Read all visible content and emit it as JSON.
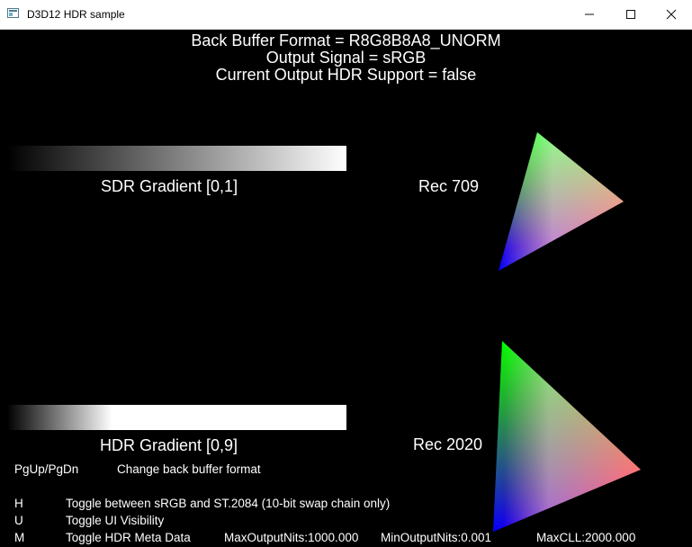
{
  "window": {
    "title": "D3D12 HDR sample"
  },
  "header": {
    "line1": "Back Buffer Format = R8G8B8A8_UNORM",
    "line2": "Output Signal = sRGB",
    "line3": "Current Output HDR Support = false"
  },
  "gradients": {
    "sdr_label": "SDR Gradient [0,1]",
    "hdr_label": "HDR Gradient [0,9]"
  },
  "gamuts": {
    "rec709_label": "Rec 709",
    "rec2020_label": "Rec 2020",
    "colors": {
      "red": "#ff0000",
      "green": "#00ff00",
      "blue": "#0000ff"
    }
  },
  "help": {
    "pgkey": "PgUp/PgDn",
    "pgdesc": "Change back buffer format",
    "h_key": "H",
    "h_desc": "Toggle between sRGB and ST.2084 (10-bit swap chain only)",
    "u_key": "U",
    "u_desc": "Toggle UI Visibility",
    "m_key": "M",
    "m_desc": "Toggle HDR Meta Data"
  },
  "metadata": {
    "max_output": "MaxOutputNits:1000.000",
    "min_output": "MinOutputNits:0.001",
    "max_cll": "MaxCLL:2000.000"
  }
}
